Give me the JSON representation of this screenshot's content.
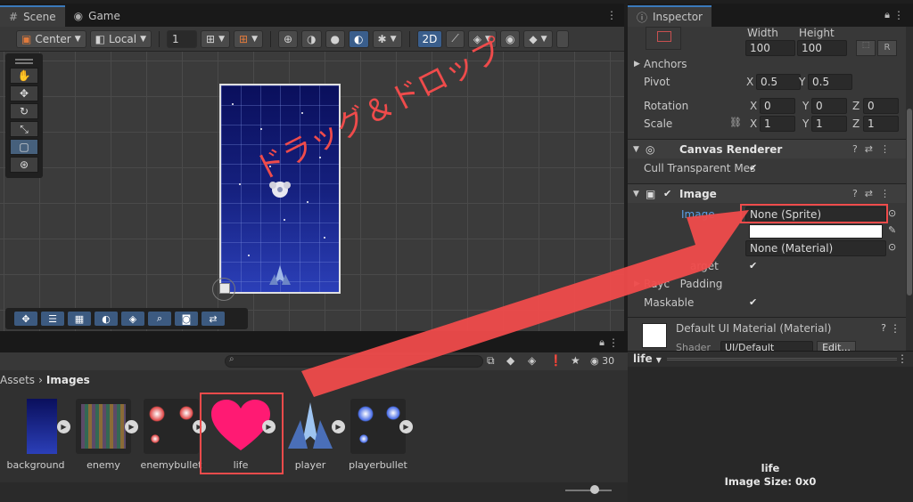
{
  "tabs": {
    "scene": "Scene",
    "game": "Game",
    "inspector": "Inspector"
  },
  "scene_toolbar": {
    "pivot": "Center",
    "space": "Local",
    "grid_size": "1",
    "mode_2d": "2D"
  },
  "project": {
    "count": "30",
    "breadcrumb_root": "Assets",
    "breadcrumb_current": "Images",
    "assets": [
      {
        "label": "background"
      },
      {
        "label": "enemy"
      },
      {
        "label": "enemybullet"
      },
      {
        "label": "life"
      },
      {
        "label": "player"
      },
      {
        "label": "playerbullet"
      }
    ]
  },
  "inspector": {
    "width_label": "Width",
    "height_label": "Height",
    "width": "100",
    "height": "100",
    "r_btn": "R",
    "anchors": "Anchors",
    "pivot": "Pivot",
    "pivot_x": "0.5",
    "pivot_y": "0.5",
    "rotation": "Rotation",
    "rot_x": "0",
    "rot_y": "0",
    "rot_z": "0",
    "scale": "Scale",
    "scale_x": "1",
    "scale_y": "1",
    "scale_z": "1",
    "x": "X",
    "y": "Y",
    "z": "Z",
    "canvas_renderer": "Canvas Renderer",
    "cull_transparent": "Cull Transparent Mes",
    "image": "Image",
    "source_image": "Image",
    "source_image_value": "None (Sprite)",
    "material_value": "None (Material)",
    "raycast_target": "arget",
    "raycast_padding": "Rayc   Padding",
    "maskable": "Maskable",
    "default_material": "Default UI Material (Material)",
    "shader_label": "Shader",
    "shader_value": "UI/Default",
    "edit": "Edit..."
  },
  "preview": {
    "dropdown": "life",
    "name": "life",
    "size": "Image Size: 0x0"
  },
  "annotation": {
    "text": "ドラッグ＆ドロップ",
    "color": "#ef4b4b"
  }
}
